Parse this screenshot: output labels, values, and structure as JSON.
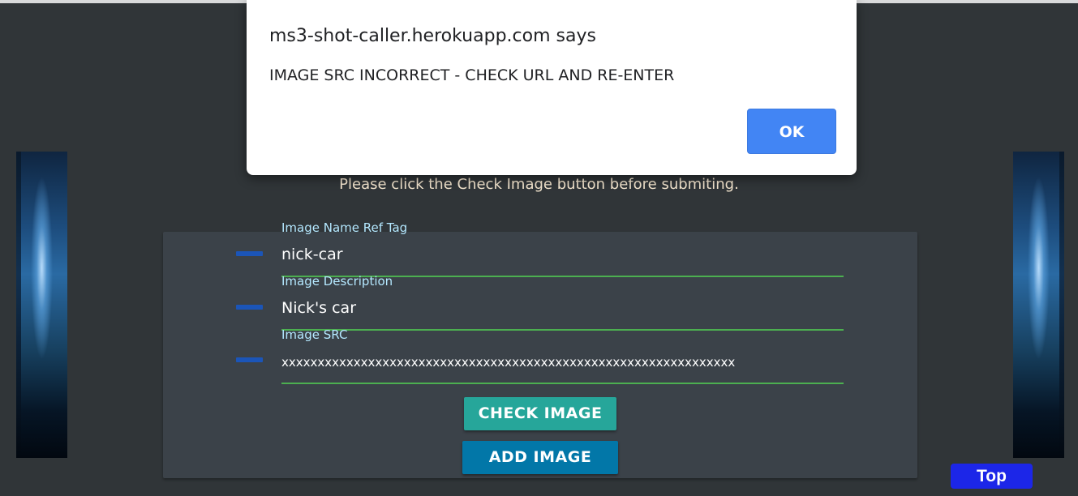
{
  "dialog": {
    "title": "ms3-shot-caller.herokuapp.com says",
    "message": "IMAGE SRC INCORRECT - CHECK URL AND RE-ENTER",
    "ok_label": "OK",
    "accent_color": "#4285f4"
  },
  "instruction": "Please click the Check Image button before submiting.",
  "form": {
    "fields": [
      {
        "label": "Image Name Ref Tag",
        "value": "nick-car",
        "icon": "field-marker-icon"
      },
      {
        "label": "Image Description",
        "value": "Nick's car",
        "icon": "field-marker-icon"
      },
      {
        "label": "Image SRC",
        "value": "xxxxxxxxxxxxxxxxxxxxxxxxxxxxxxxxxxxxxxxxxxxxxxxxxxxxxxxxxxxxxxx",
        "icon": "field-marker-icon"
      }
    ],
    "check_button": "CHECK IMAGE",
    "add_button": "ADD IMAGE",
    "underline_color": "#4caf50",
    "check_button_color": "#26a69a",
    "add_button_color": "#0277a8"
  },
  "top_button": "Top",
  "top_button_color": "#1c26e8"
}
